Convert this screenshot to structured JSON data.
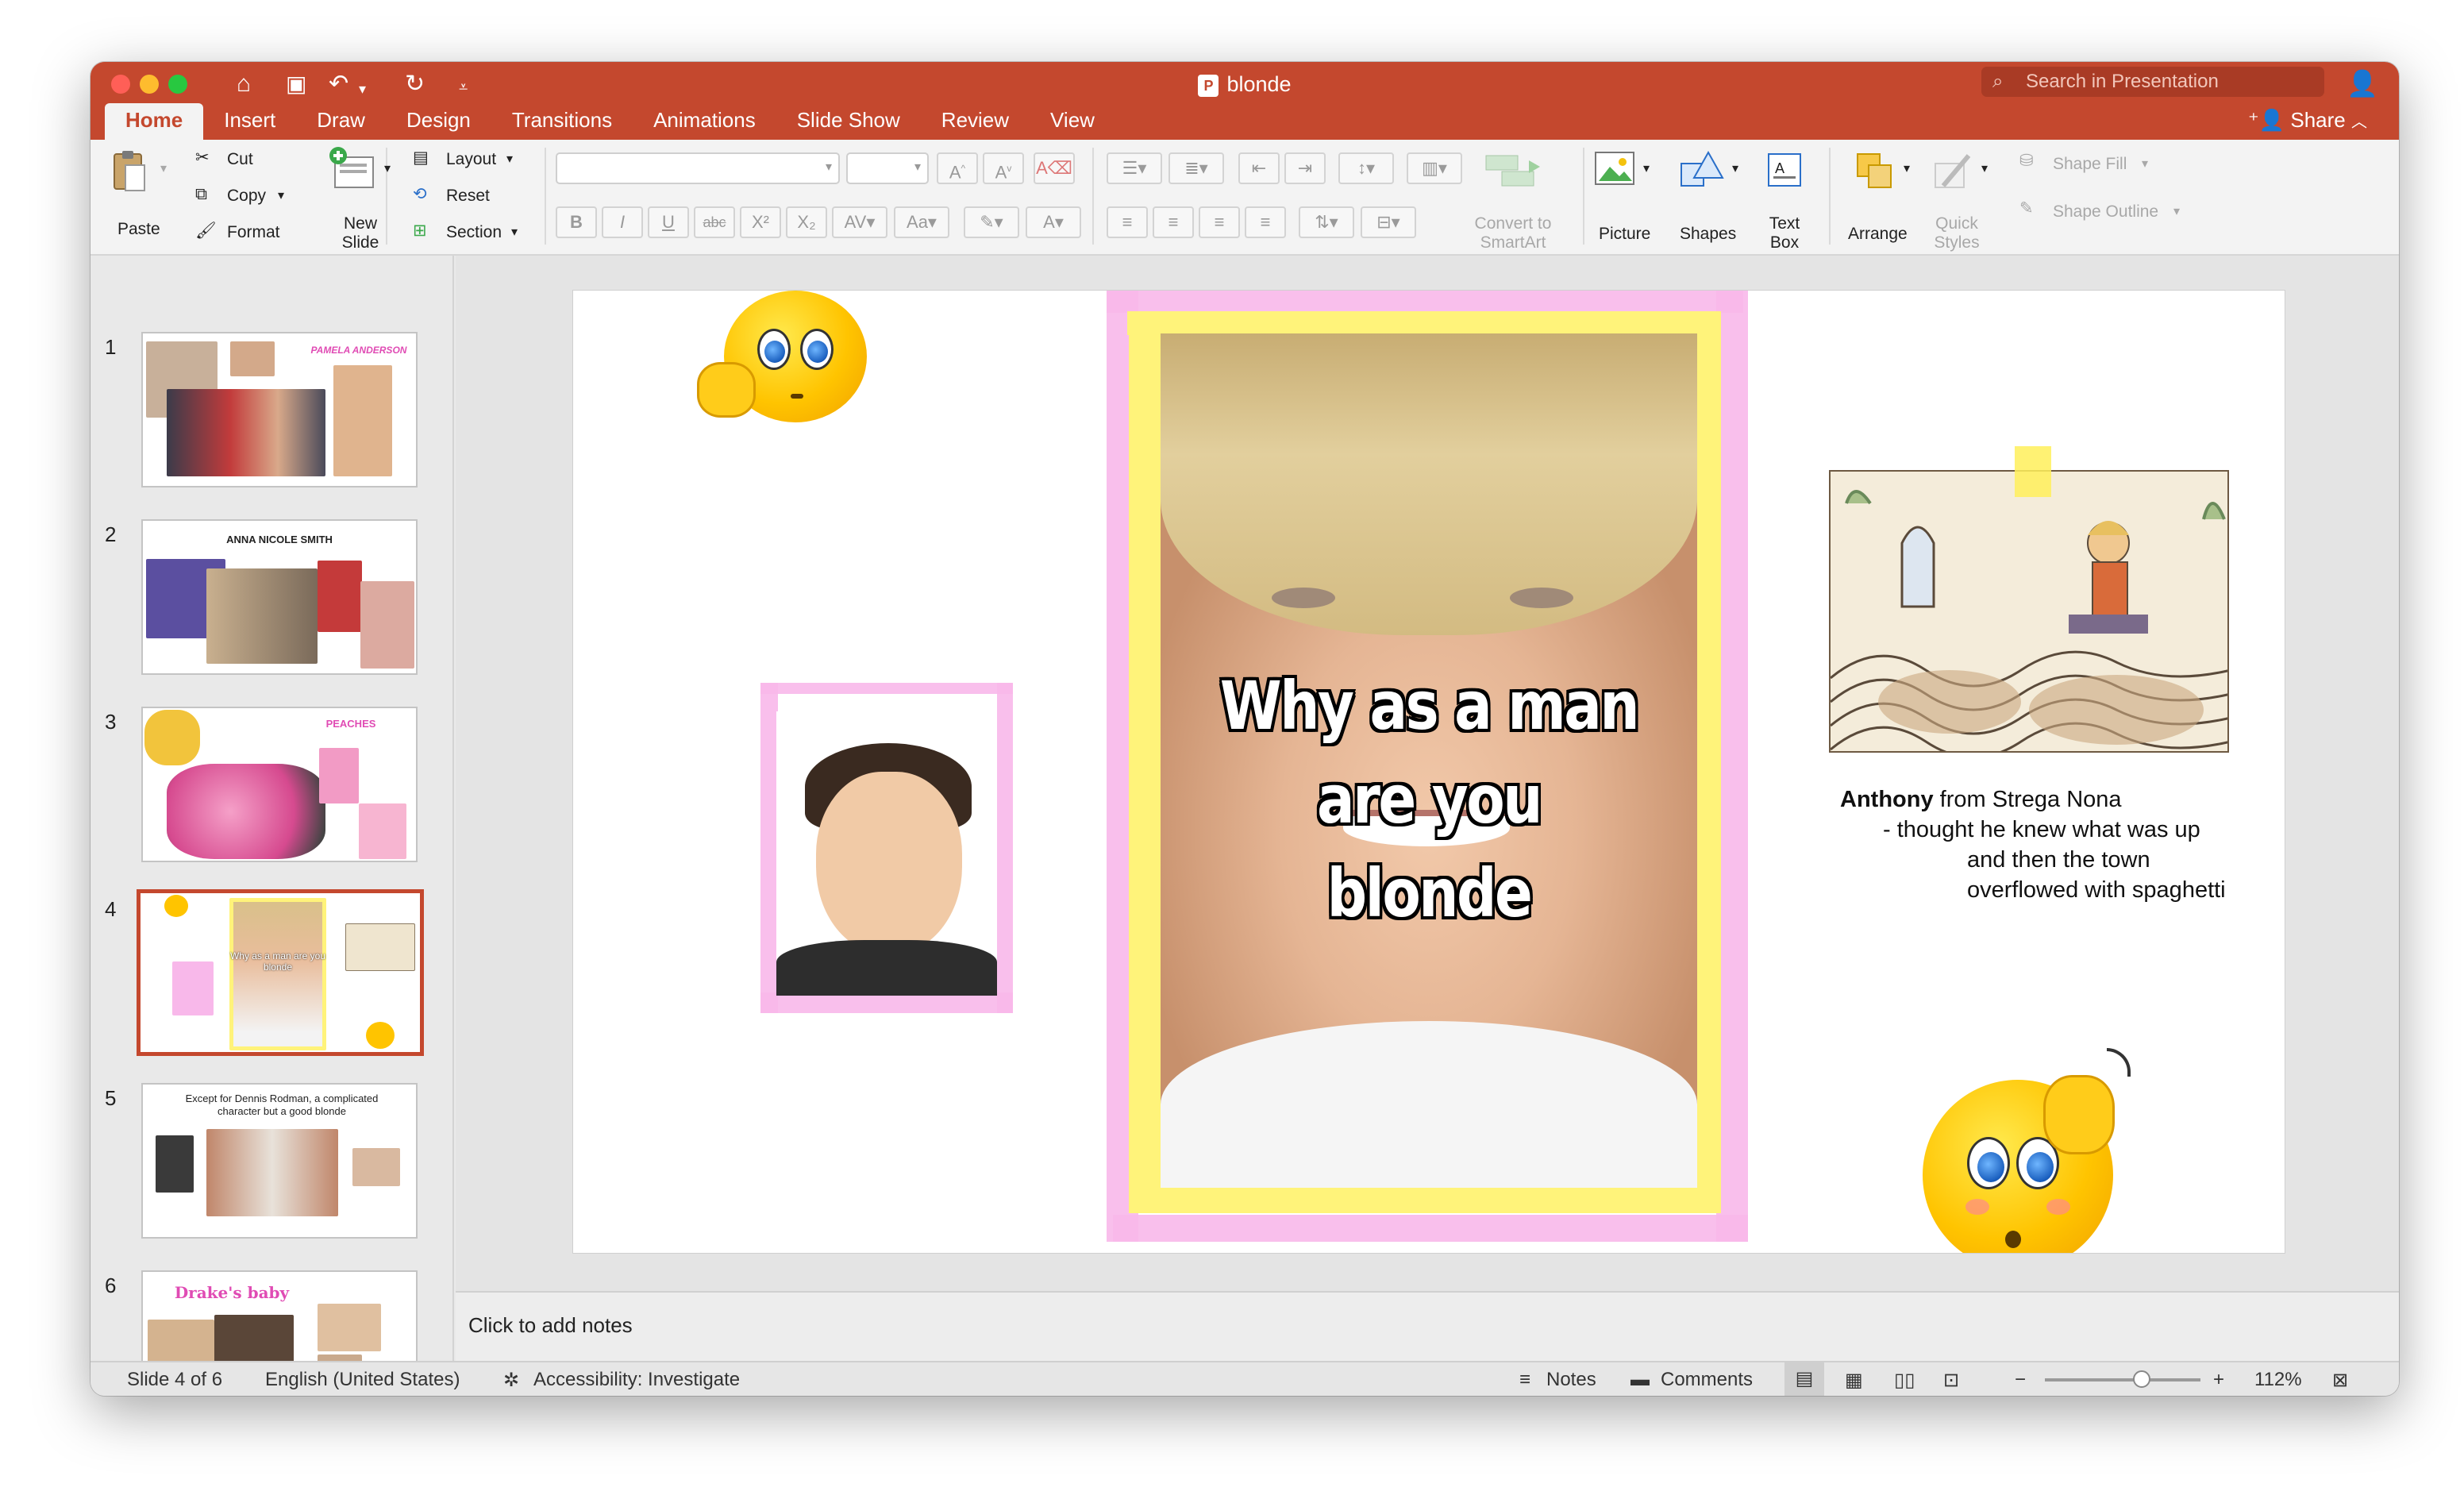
{
  "window": {
    "title": "blonde",
    "search_placeholder": "Search in Presentation",
    "share_label": "Share"
  },
  "tabs": [
    "Home",
    "Insert",
    "Draw",
    "Design",
    "Transitions",
    "Animations",
    "Slide Show",
    "Review",
    "View"
  ],
  "ribbon": {
    "paste": "Paste",
    "cut": "Cut",
    "copy": "Copy",
    "format": "Format",
    "new_slide": "New\nSlide",
    "layout": "Layout",
    "reset": "Reset",
    "section": "Section",
    "convert_smartart": "Convert to\nSmartArt",
    "picture": "Picture",
    "shapes": "Shapes",
    "text_box": "Text\nBox",
    "arrange": "Arrange",
    "quick_styles": "Quick\nStyles",
    "shape_fill": "Shape Fill",
    "shape_outline": "Shape Outline"
  },
  "thumbnails": [
    {
      "number": "1",
      "title": "PAMELA ANDERSON"
    },
    {
      "number": "2",
      "title": "ANNA NICOLE SMITH"
    },
    {
      "number": "3",
      "title": "PEACHES"
    },
    {
      "number": "4",
      "title": "Why as a man are you blonde"
    },
    {
      "number": "5",
      "title": "Except for Dennis Rodman, a complicated character but a good blonde"
    },
    {
      "number": "6",
      "title": "Drake's baby"
    }
  ],
  "slide": {
    "caption_line1": "Why as a man are you",
    "caption_line2": "blonde",
    "anthony_bold": "Anthony",
    "anthony_rest": " from Strega Nona",
    "line2": "- thought he knew what was up",
    "line3": "and then the town",
    "line4": "overflowed with spaghetti"
  },
  "notes_placeholder": "Click to add notes",
  "status": {
    "slide_counter": "Slide 4 of 6",
    "language": "English (United States)",
    "accessibility": "Accessibility: Investigate",
    "notes": "Notes",
    "comments": "Comments",
    "zoom": "112%",
    "zoom_level": 0.62
  },
  "colors": {
    "accent": "#c4482e",
    "frame_pink": "#f8b8ea",
    "frame_yellow": "#fff37a"
  }
}
